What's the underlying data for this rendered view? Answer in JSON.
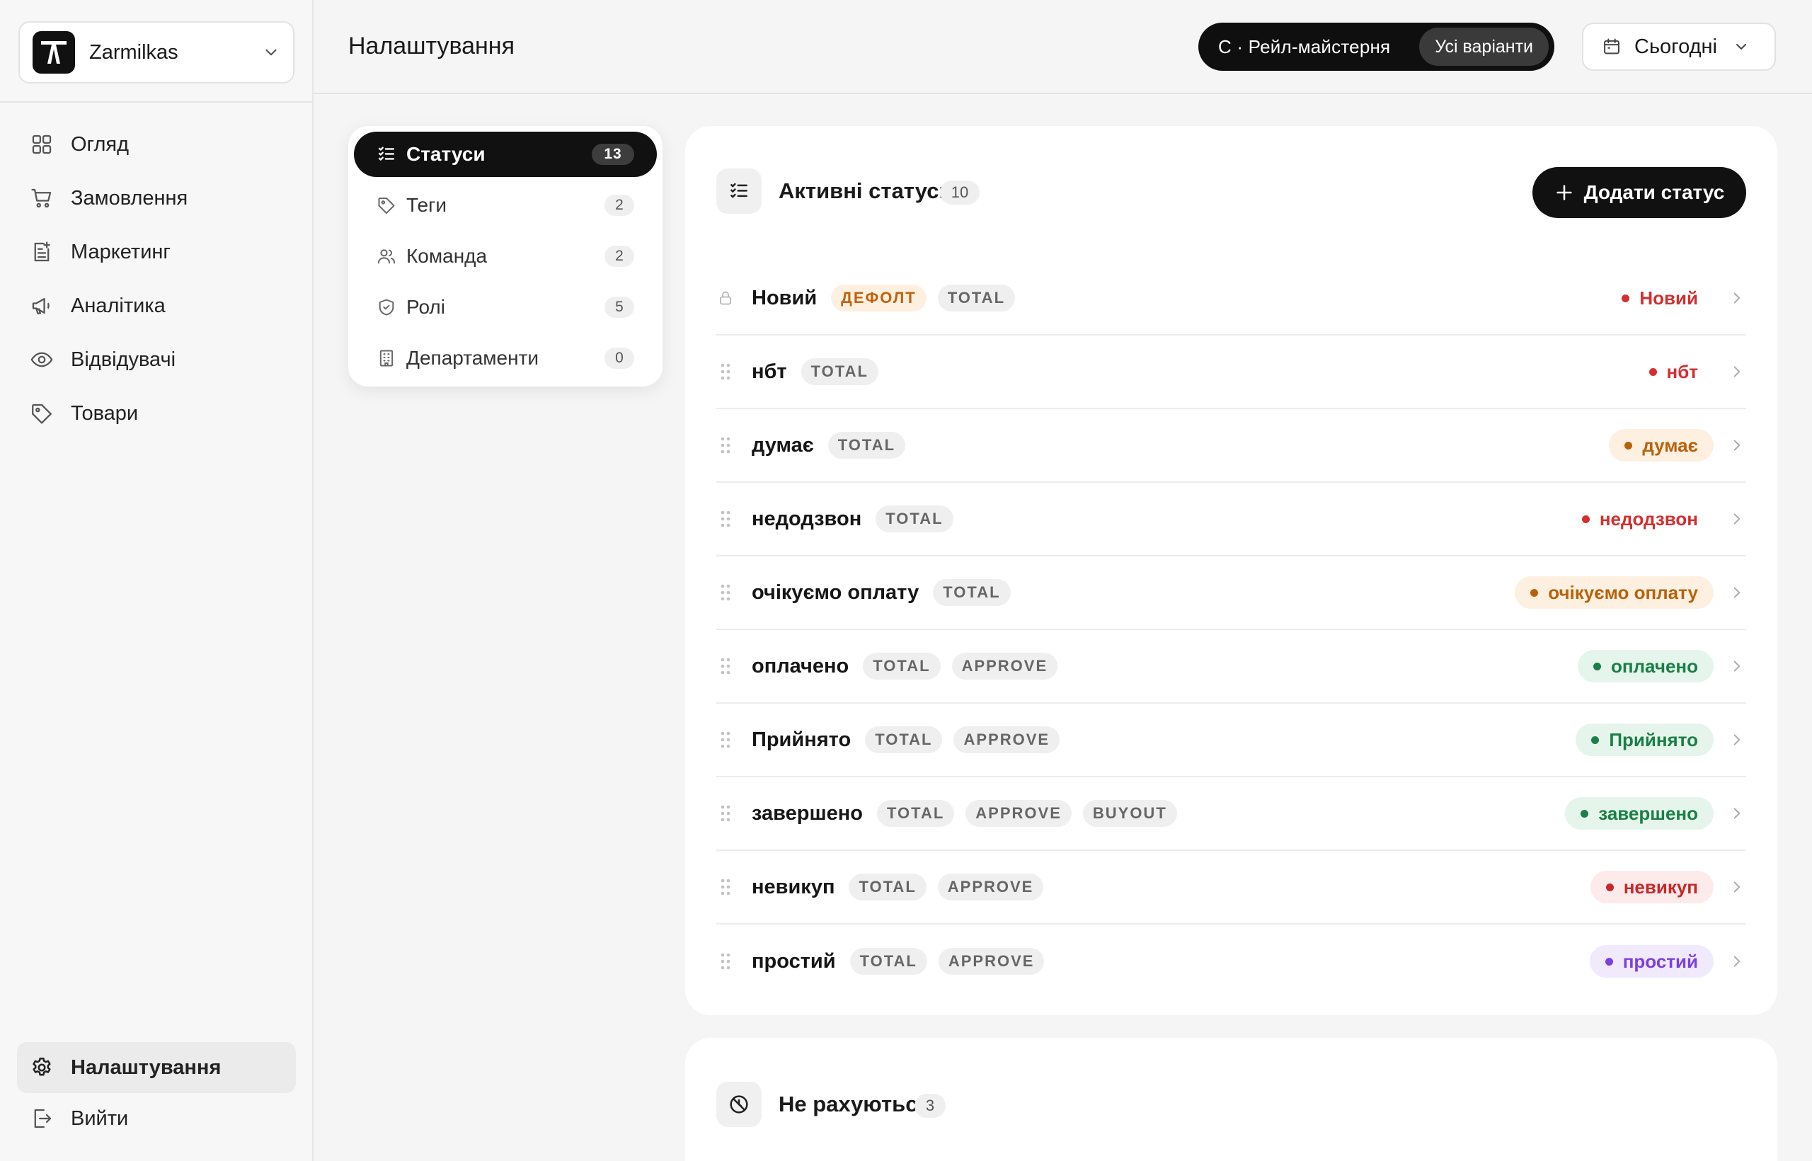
{
  "org": {
    "name": "Zarmilkas"
  },
  "sidebar": {
    "items": [
      {
        "label": "Огляд",
        "icon": "grid-icon"
      },
      {
        "label": "Замовлення",
        "icon": "cart-icon"
      },
      {
        "label": "Маркетинг",
        "icon": "marketing-icon"
      },
      {
        "label": "Аналітика",
        "icon": "megaphone-icon"
      },
      {
        "label": "Відвідувачі",
        "icon": "eye-icon"
      },
      {
        "label": "Товари",
        "icon": "tag-icon"
      }
    ],
    "settings_label": "Налаштування",
    "logout_label": "Вийти"
  },
  "header": {
    "title": "Налаштування",
    "workspace": "С · Рейл-майстерня",
    "variant": "Усі варіанти",
    "date": "Сьогодні"
  },
  "subnav": [
    {
      "label": "Статуси",
      "count": "13",
      "icon": "list-check-icon"
    },
    {
      "label": "Теги",
      "count": "2",
      "icon": "tag-icon"
    },
    {
      "label": "Команда",
      "count": "2",
      "icon": "users-icon"
    },
    {
      "label": "Ролі",
      "count": "5",
      "icon": "shield-icon"
    },
    {
      "label": "Департаменти",
      "count": "0",
      "icon": "building-icon"
    }
  ],
  "active_card": {
    "title": "Активні статуси",
    "count": "10",
    "add_label": "Додати статус"
  },
  "statuses": [
    {
      "name": "Новий",
      "locked": true,
      "tags": [
        "ДЕФОЛТ",
        "TOTAL"
      ],
      "pill": "Новий",
      "color": "#d32f2f",
      "bg": "transparent"
    },
    {
      "name": "нбт",
      "tags": [
        "TOTAL"
      ],
      "pill": "нбт",
      "color": "#d32f2f",
      "bg": "transparent"
    },
    {
      "name": "думає",
      "tags": [
        "TOTAL"
      ],
      "pill": "думає",
      "color": "#b8620b",
      "bg": "#fdf0e1"
    },
    {
      "name": "недодзвон",
      "tags": [
        "TOTAL"
      ],
      "pill": "недодзвон",
      "color": "#d32f2f",
      "bg": "transparent"
    },
    {
      "name": "очікуємо оплату",
      "tags": [
        "TOTAL"
      ],
      "pill": "очікуємо оплату",
      "color": "#b8620b",
      "bg": "#fdf0e1"
    },
    {
      "name": "оплачено",
      "tags": [
        "TOTAL",
        "APPROVE"
      ],
      "pill": "оплачено",
      "color": "#1b7f47",
      "bg": "#e6f5ec"
    },
    {
      "name": "Прийнято",
      "tags": [
        "TOTAL",
        "APPROVE"
      ],
      "pill": "Прийнято",
      "color": "#1b7f47",
      "bg": "#e6f5ec"
    },
    {
      "name": "завершено",
      "tags": [
        "TOTAL",
        "APPROVE",
        "BUYOUT"
      ],
      "pill": "завершено",
      "color": "#1b7f47",
      "bg": "#e6f5ec"
    },
    {
      "name": "невикуп",
      "tags": [
        "TOTAL",
        "APPROVE"
      ],
      "pill": "невикуп",
      "color": "#c62828",
      "bg": "#fdeaea"
    },
    {
      "name": "простий",
      "tags": [
        "TOTAL",
        "APPROVE"
      ],
      "pill": "простий",
      "color": "#7b3fe4",
      "bg": "#f1eafd"
    }
  ],
  "inactive_card": {
    "title": "Не рахуються",
    "count": "3"
  }
}
